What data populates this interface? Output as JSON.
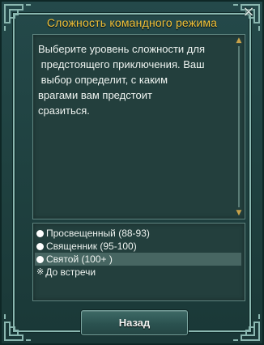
{
  "dialog": {
    "title": "Сложность командного режима",
    "close_icon": "×"
  },
  "description": {
    "text": "Выберите уровень сложности для\n предстоящего приключения. Ваш\n выбор определит, с каким\nврагами вам предстоит\nсразиться."
  },
  "options": [
    {
      "label": "Просвещенный (88-93)",
      "marker": "bullet",
      "selected": false
    },
    {
      "label": "Священник (95-100)",
      "marker": "bullet",
      "selected": false
    },
    {
      "label": "Святой (100+ )",
      "marker": "bullet",
      "selected": true
    },
    {
      "label": "До встречи",
      "marker": "※",
      "selected": false
    }
  ],
  "buttons": {
    "back_label": "Назад"
  },
  "colors": {
    "title": "#f0c23a",
    "frame": "#8ab7b0",
    "panel": "#233f3d"
  }
}
